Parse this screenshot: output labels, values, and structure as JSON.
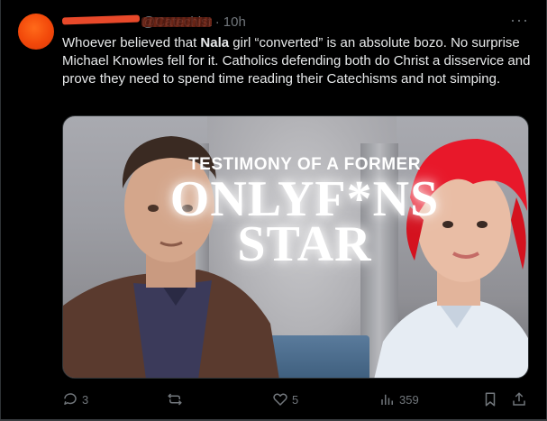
{
  "post": {
    "author_handle": "@Catechist",
    "separator": "·",
    "time": "10h",
    "more": "···",
    "text_before": "Whoever believed that ",
    "text_bold": "Nala",
    "text_after": " girl “converted” is an absolute bozo. No surprise Michael Knowles fell for it. Catholics defending both do Christ a disservice and prove they need to spend time reading their Catechisms and not simping."
  },
  "media": {
    "line1": "TESTIMONY OF A FORMER",
    "line2": "ONLYF*NS",
    "line3": "STAR"
  },
  "actions": {
    "replies": "3",
    "reposts": "",
    "likes": "5",
    "views": "359"
  },
  "colors": {
    "background": "#000000",
    "text": "#e7e9ea",
    "muted": "#71767b",
    "avatar": "#f2480a"
  }
}
